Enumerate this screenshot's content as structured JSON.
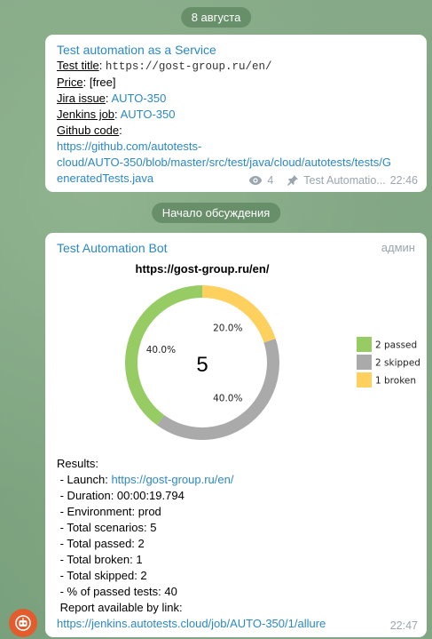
{
  "date_pill": "8 августа",
  "discussion_pill": "Начало обсуждения",
  "post": {
    "channel_name": "Test automation as a Service",
    "test_title_label": "Test title",
    "test_title_value": "https://gost-group.ru/en/",
    "price_label": "Price",
    "price_value": "[free]",
    "jira_label": "Jira issue",
    "jira_value": "AUTO-350",
    "jenkins_label": "Jenkins job",
    "jenkins_value": "AUTO-350",
    "github_label": "Github code",
    "github_line1": "https://github.com/autotests-",
    "github_line2": "cloud/AUTO-350/blob/master/src/test/java/cloud/autotests/tests/G",
    "github_line3": "eneratedTests.java",
    "views": "4",
    "author": "Test Automatio...",
    "time": "22:46"
  },
  "bot_message": {
    "sender": "Test Automation Bot",
    "role": "админ",
    "results_title": "Results:",
    "launch_label": " - Launch: ",
    "launch_link": "https://gost-group.ru/en/",
    "duration": " - Duration: 00:00:19.794",
    "environment": " - Environment: prod",
    "total_scenarios": " - Total scenarios: 5",
    "total_passed": " - Total passed: 2",
    "total_broken": " - Total broken: 1",
    "total_skipped": " - Total skipped: 2",
    "percent_passed": " - % of passed tests: 40",
    "report_label": " Report available by link:",
    "report_link": "https://jenkins.autotests.cloud/job/AUTO-350/1/allure",
    "time": "22:47"
  },
  "chart_data": {
    "type": "pie",
    "title": "https://gost-group.ru/en/",
    "center_label": "5",
    "categories": [
      "passed",
      "skipped",
      "broken"
    ],
    "values": [
      2,
      2,
      1
    ],
    "percent_labels": [
      "40.0%",
      "40.0%",
      "20.0%"
    ],
    "legend": [
      "2 passed",
      "2 skipped",
      "1 broken"
    ],
    "colors": [
      "#97cc64",
      "#aaaaaa",
      "#fed05d"
    ],
    "legend_position": "right"
  },
  "colors": {
    "link": "#2b88c5",
    "meta": "#9aa5ae",
    "pill_bg": "#628a64",
    "avatar": "#e25c2e"
  }
}
